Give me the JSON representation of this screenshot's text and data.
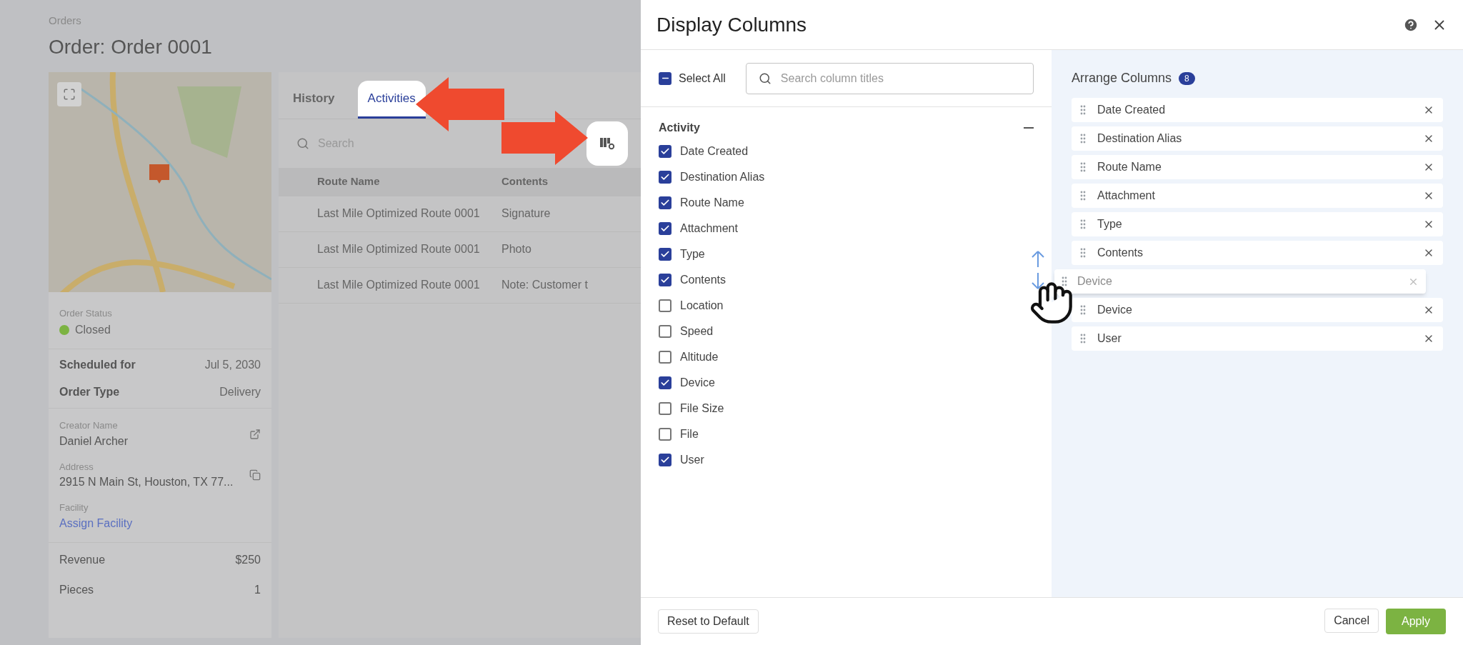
{
  "page": {
    "breadcrumb": "Orders",
    "title": "Order: Order 0001"
  },
  "order_card": {
    "status": {
      "label": "Order Status",
      "text": "Closed",
      "color": "#7cb342"
    },
    "summary": [
      {
        "label": "Scheduled for",
        "value": "Jul 5, 2030"
      },
      {
        "label": "Order Type",
        "value": "Delivery"
      }
    ],
    "fields": [
      {
        "label": "Creator Name",
        "value": "Daniel Archer",
        "kind": "external"
      },
      {
        "label": "Address",
        "value": "2915 N Main St, Houston, TX 77...",
        "kind": "copy"
      },
      {
        "label": "Facility",
        "value": "Assign Facility",
        "kind": "link"
      }
    ],
    "totals": [
      {
        "label": "Revenue",
        "value": "$250"
      },
      {
        "label": "Pieces",
        "value": "1"
      }
    ]
  },
  "activity_panel": {
    "tabs": [
      {
        "label": "History",
        "selected": false
      },
      {
        "label": "Activities",
        "selected": true
      }
    ],
    "search": {
      "placeholder": "Search"
    },
    "columns": [
      "Route Name",
      "Contents"
    ],
    "rows": [
      [
        "Last Mile Optimized Route 0001",
        "Signature"
      ],
      [
        "Last Mile Optimized Route 0001",
        "Photo"
      ],
      [
        "Last Mile Optimized Route 0001",
        "Note: Customer t"
      ]
    ]
  },
  "dialog": {
    "title": "Display Columns",
    "select_all": {
      "label": "Select All",
      "indeterminate": true
    },
    "search": {
      "placeholder": "Search column titles"
    },
    "groups": [
      {
        "title": "Activity",
        "expanded": true,
        "items": [
          {
            "label": "Date Created",
            "checked": true
          },
          {
            "label": "Destination Alias",
            "checked": true
          },
          {
            "label": "Route Name",
            "checked": true
          },
          {
            "label": "Attachment",
            "checked": true
          },
          {
            "label": "Type",
            "checked": true
          },
          {
            "label": "Contents",
            "checked": true
          },
          {
            "label": "Location",
            "checked": false
          },
          {
            "label": "Speed",
            "checked": false
          },
          {
            "label": "Altitude",
            "checked": false
          },
          {
            "label": "Device",
            "checked": true
          },
          {
            "label": "File Size",
            "checked": false
          },
          {
            "label": "File",
            "checked": false
          },
          {
            "label": "User",
            "checked": true
          }
        ]
      }
    ],
    "arrange": {
      "title": "Arrange Columns",
      "count": "8",
      "items": [
        "Date Created",
        "Destination Alias",
        "Route Name",
        "Attachment",
        "Type",
        "Contents",
        "Device",
        "User"
      ],
      "dragging": "Device"
    },
    "footer": {
      "reset": "Reset to Default",
      "cancel": "Cancel",
      "apply": "Apply"
    }
  }
}
